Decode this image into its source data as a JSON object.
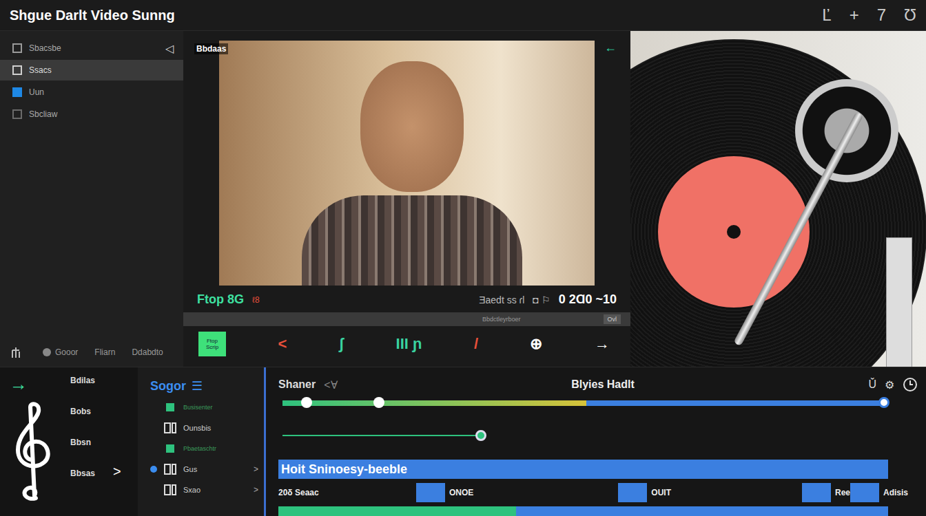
{
  "window": {
    "title": "Shgue Darlt Video Sunng",
    "actions": [
      "Ľ",
      "+",
      "7",
      "Ʊ"
    ]
  },
  "sidebar": {
    "collapse": "◁",
    "items": [
      {
        "label": "Sbacsbe",
        "selected": false,
        "color": "#9a9a9a"
      },
      {
        "label": "Ssacs",
        "selected": true,
        "color": "#cfcfcf"
      },
      {
        "label": "Uun",
        "selected": false,
        "color": "#1e88e5"
      },
      {
        "label": "Sbcliaw",
        "selected": false,
        "color": "#6a6a6a"
      }
    ],
    "footer": [
      "Gooor",
      "Fliarn",
      "Ddabdto"
    ]
  },
  "preview": {
    "label": "Bbdaas",
    "back": "←",
    "status": {
      "left": "Ftop 8G",
      "mark": "ℓ8",
      "info": "Ǝaedt ss ɾl",
      "flags": "◘ ⚐",
      "time": "0 2Ɑ0 ~10"
    },
    "scrub": {
      "label": "Bbdctleyrboer",
      "end": "Ovl"
    },
    "tools": [
      {
        "label": "Ftop Scrip",
        "kind": "button",
        "color": "#3ee07a"
      },
      {
        "label": "<",
        "kind": "glyph",
        "color": "#e8503a"
      },
      {
        "label": "ʃ",
        "kind": "glyph",
        "color": "#39d3a0"
      },
      {
        "label": "III ɲ",
        "kind": "glyph",
        "color": "#39d3a0"
      },
      {
        "label": "/",
        "kind": "glyph",
        "color": "#e8503a"
      },
      {
        "label": "⊕",
        "kind": "glyph",
        "color": "#ffffff"
      },
      {
        "label": "→",
        "kind": "glyph",
        "color": "#ffffff"
      }
    ]
  },
  "library": {
    "arrow": "→",
    "items": [
      "Bdilas",
      "Bobs",
      "Bbsn",
      "Bbsas"
    ],
    "next": ">"
  },
  "tracks": {
    "title": "Sogor",
    "menu": "☰",
    "items": [
      {
        "label": "Busisenter",
        "kind": "swatch",
        "selected": false,
        "chevron": ""
      },
      {
        "label": "Ounsbis",
        "kind": "glyph",
        "selected": false,
        "chevron": ""
      },
      {
        "label": "Pbaetaschtr",
        "kind": "swatch",
        "selected": false,
        "chevron": ""
      },
      {
        "label": "Gus",
        "kind": "glyph",
        "selected": true,
        "chevron": ">"
      },
      {
        "label": "Sxao",
        "kind": "glyph",
        "selected": false,
        "chevron": ">"
      }
    ]
  },
  "timeline": {
    "title": "Shaner",
    "nav": "<Ɐ",
    "name": "Blyies Hadlt",
    "icons": [
      "Ǔ",
      "⚙"
    ],
    "progress": {
      "level": 0.505
    },
    "knobs": [
      0.04,
      0.16,
      1.0
    ],
    "sub": {
      "level": 0.33
    },
    "clip": "Hoit Sninoesy-beeble",
    "rowLabel": "20δ Seaac",
    "cues": [
      {
        "label": "ONOE"
      },
      {
        "label": "OUIT"
      },
      {
        "label": "Ree"
      },
      {
        "label": "Adisis"
      }
    ],
    "bottom": {
      "level": 0.39
    }
  }
}
